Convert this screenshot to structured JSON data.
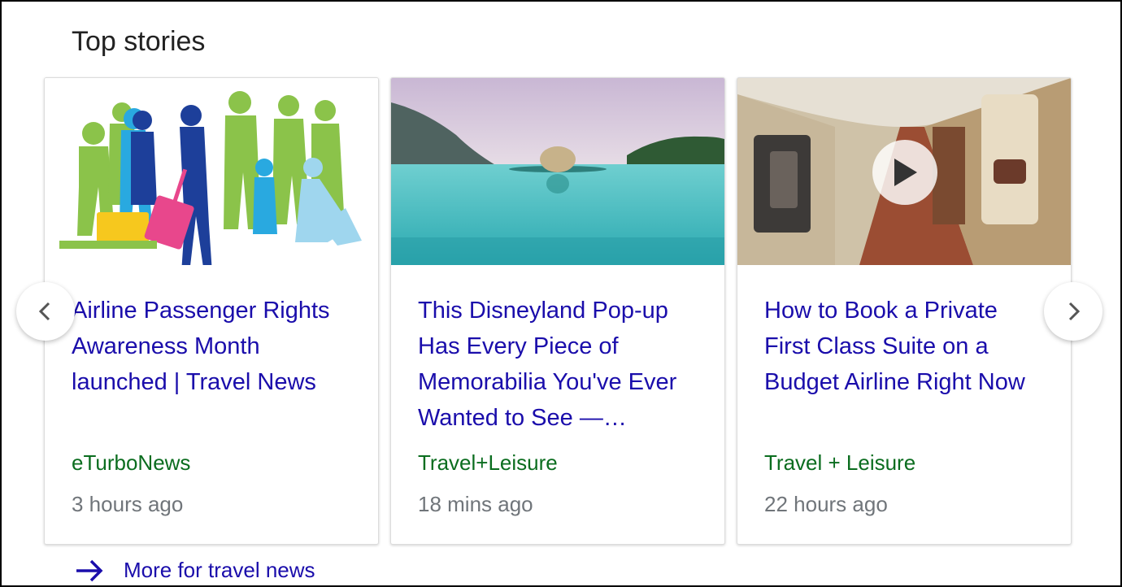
{
  "section": {
    "title": "Top stories"
  },
  "stories": [
    {
      "headline": "Airline Passenger Rights Awareness Month launched | Travel News",
      "source": "eTurboNews",
      "time": "3 hours ago",
      "image": "people-silhouettes-illustration"
    },
    {
      "headline": "This Disneyland Pop-up Has Every Piece of Memorabilia You've Ever Wanted to See —…",
      "source": "Travel+Leisure",
      "time": "18 mins ago",
      "image": "infinity-pool-swimmer-photo"
    },
    {
      "headline": "How to Book a Private First Class Suite on a Budget Airline Right Now",
      "source": "Travel + Leisure",
      "time": "22 hours ago",
      "image": "airplane-cabin-video-thumbnail"
    }
  ],
  "navigation": {
    "prev_icon": "chevron-left-icon",
    "next_icon": "chevron-right-icon"
  },
  "more": {
    "label": "More for travel news",
    "icon": "arrow-right-icon"
  },
  "colors": {
    "link": "#1a0dab",
    "source": "#0b6d1f",
    "time": "#70757a"
  }
}
